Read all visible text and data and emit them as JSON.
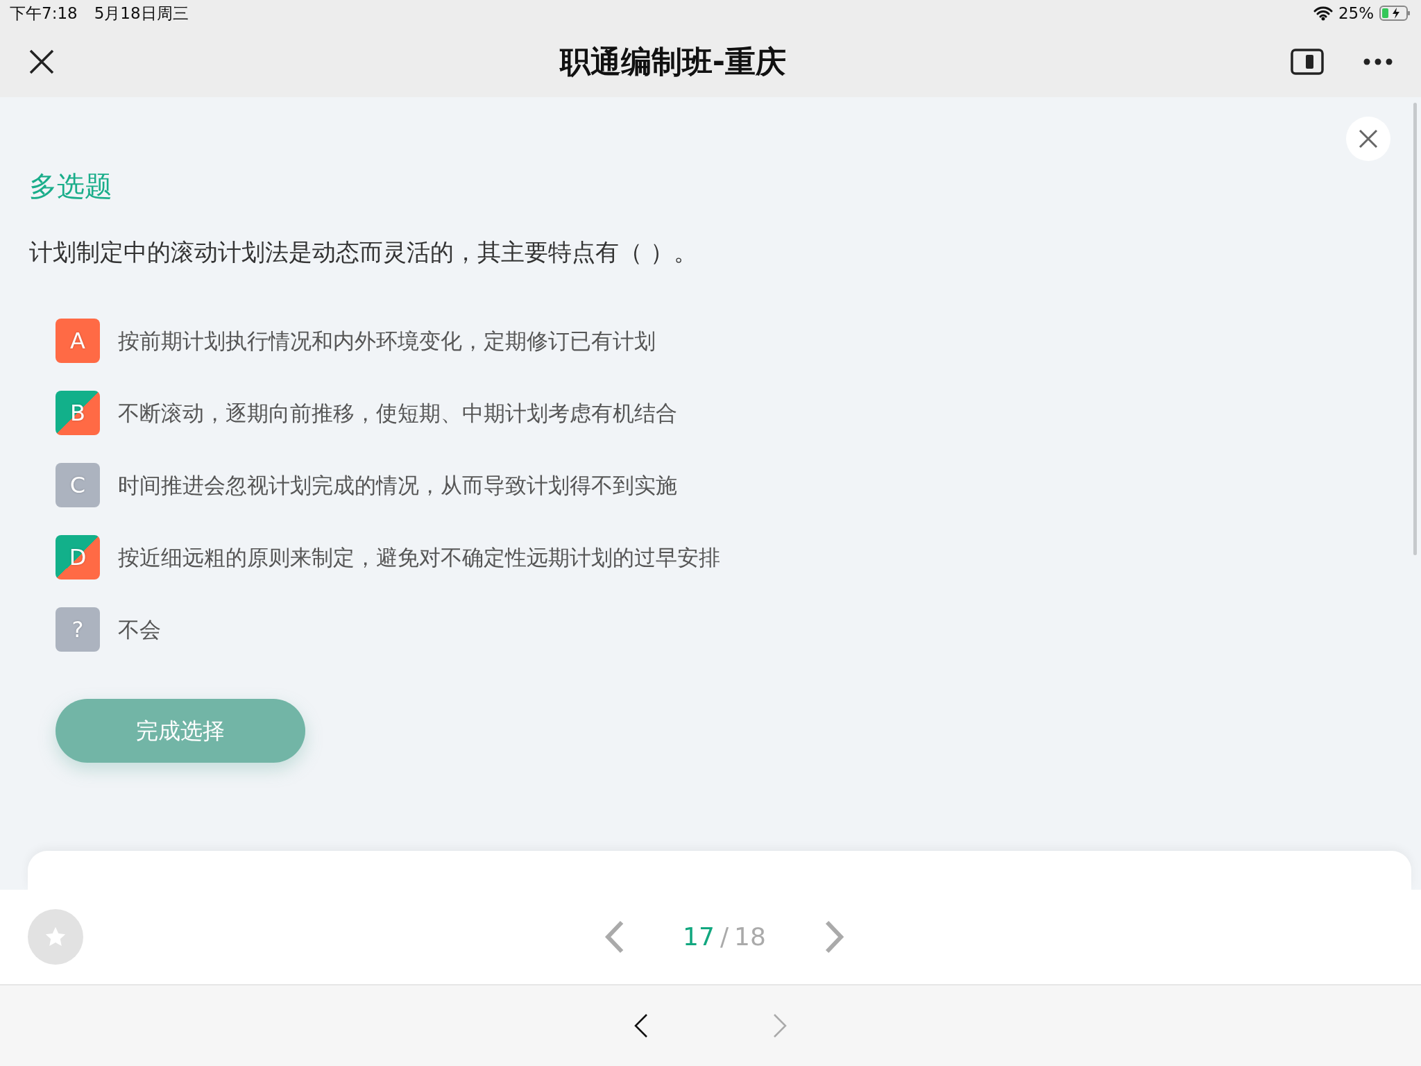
{
  "status_bar": {
    "time": "下午7:18",
    "date": "5月18日周三",
    "battery": "25%"
  },
  "nav": {
    "title": "职通编制班-重庆"
  },
  "question": {
    "type_label": "多选题",
    "text": "计划制定中的滚动计划法是动态而灵活的，其主要特点有（ ）。",
    "options": [
      {
        "letter": "A",
        "text": "按前期计划执行情况和内外环境变化，定期修订已有计划",
        "selected": true,
        "correct": false
      },
      {
        "letter": "B",
        "text": "不断滚动，逐期向前推移，使短期、中期计划考虑有机结合",
        "selected": true,
        "correct": true
      },
      {
        "letter": "C",
        "text": "时间推进会忽视计划完成的情况，从而导致计划得不到实施",
        "selected": false,
        "correct": false
      },
      {
        "letter": "D",
        "text": "按近细远粗的原则来制定，避免对不确定性远期计划的过早安排",
        "selected": true,
        "correct": true
      },
      {
        "letter": "?",
        "text": "不会",
        "selected": false,
        "correct": false
      }
    ],
    "submit": "完成选择"
  },
  "pager": {
    "current": "17",
    "separator": "/",
    "total": "18"
  }
}
